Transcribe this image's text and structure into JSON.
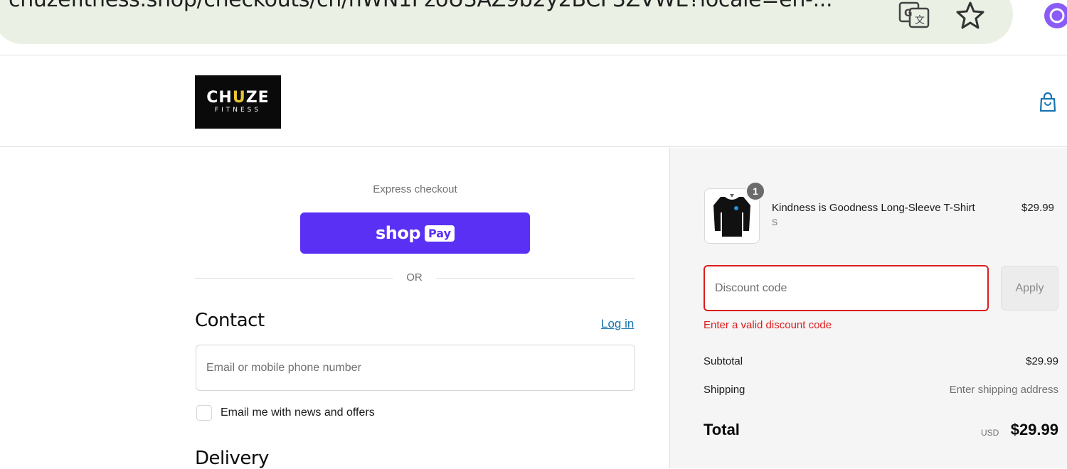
{
  "browser": {
    "url": "chuzefitness.shop/checkouts/cn/hWN1PzoU3AZ9b2y2BCF3ZVWE?locale=en-..."
  },
  "header": {
    "logo_main_pre": "CH",
    "logo_main_u": "U",
    "logo_main_post": "ZE",
    "logo_sub": "FITNESS"
  },
  "express": {
    "label": "Express checkout",
    "shop_word": "shop",
    "pay_word": "Pay"
  },
  "divider": {
    "or": "OR"
  },
  "contact": {
    "heading": "Contact",
    "login": "Log in",
    "email_placeholder": "Email or mobile phone number",
    "news_label": "Email me with news and offers"
  },
  "delivery": {
    "heading": "Delivery"
  },
  "summary": {
    "item": {
      "name": "Kindness is Goodness Long-Sleeve T-Shirt",
      "variant": "S",
      "price": "$29.99",
      "quantity": "1"
    },
    "discount": {
      "placeholder": "Discount code",
      "apply": "Apply",
      "error": "Enter a valid discount code"
    },
    "subtotal_label": "Subtotal",
    "subtotal_value": "$29.99",
    "shipping_label": "Shipping",
    "shipping_value": "Enter shipping address",
    "total_label": "Total",
    "total_currency": "USD",
    "total_value": "$29.99"
  },
  "colors": {
    "shop_pay": "#5a31f4",
    "link": "#1773b0",
    "error": "#dd1d1d",
    "summary_bg": "#f5f5f5"
  }
}
